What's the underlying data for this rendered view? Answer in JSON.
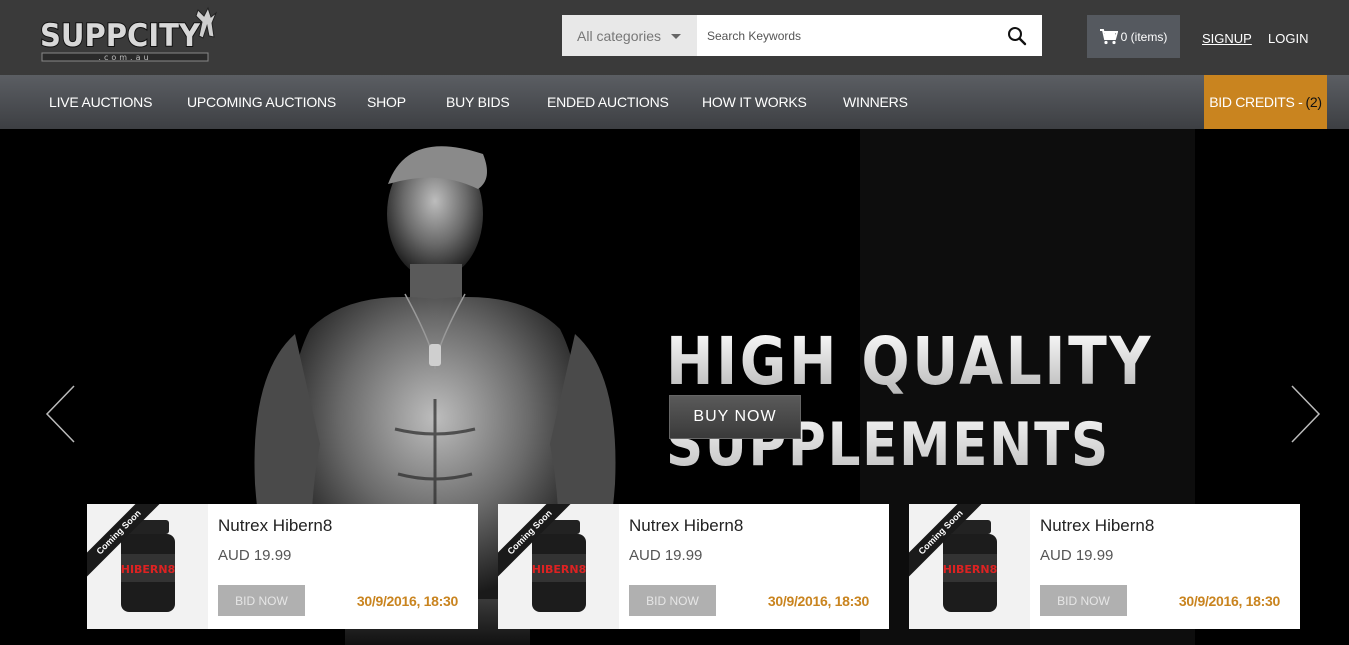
{
  "brand": {
    "logo_text": "SUPPCITY",
    "logo_sub": ".com.au"
  },
  "search": {
    "category_label": "All categories",
    "placeholder": "Search Keywords"
  },
  "cart": {
    "label": "0 (items)"
  },
  "auth": {
    "signup": "SIGNUP",
    "login": "LOGIN"
  },
  "nav": {
    "items": [
      {
        "label": "LIVE AUCTIONS"
      },
      {
        "label": "UPCOMING AUCTIONS"
      },
      {
        "label": "SHOP"
      },
      {
        "label": "BUY BIDS"
      },
      {
        "label": "ENDED AUCTIONS"
      },
      {
        "label": "HOW IT WORKS"
      },
      {
        "label": "WINNERS"
      }
    ],
    "bid_credits_label": "BID CREDITS -",
    "bid_credits_count": "(2)"
  },
  "hero": {
    "headline_line1": "HIGH QUALITY",
    "headline_line2": "SUPPLEMENTS",
    "cta": "BUY NOW"
  },
  "products": [
    {
      "ribbon": "Coming Soon",
      "bottle_label": "HIBERN8",
      "name": "Nutrex Hibern8",
      "price": "AUD 19.99",
      "button": "BID NOW",
      "date": "30/9/2016, 18:30"
    },
    {
      "ribbon": "Coming Soon",
      "bottle_label": "HIBERN8",
      "name": "Nutrex Hibern8",
      "price": "AUD 19.99",
      "button": "BID NOW",
      "date": "30/9/2016, 18:30"
    },
    {
      "ribbon": "Coming Soon",
      "bottle_label": "HIBERN8",
      "name": "Nutrex Hibern8",
      "price": "AUD 19.99",
      "button": "BID NOW",
      "date": "30/9/2016, 18:30"
    }
  ],
  "colors": {
    "accent": "#c9841f",
    "header": "#3a3a3a",
    "nav": "#4b4e52"
  }
}
